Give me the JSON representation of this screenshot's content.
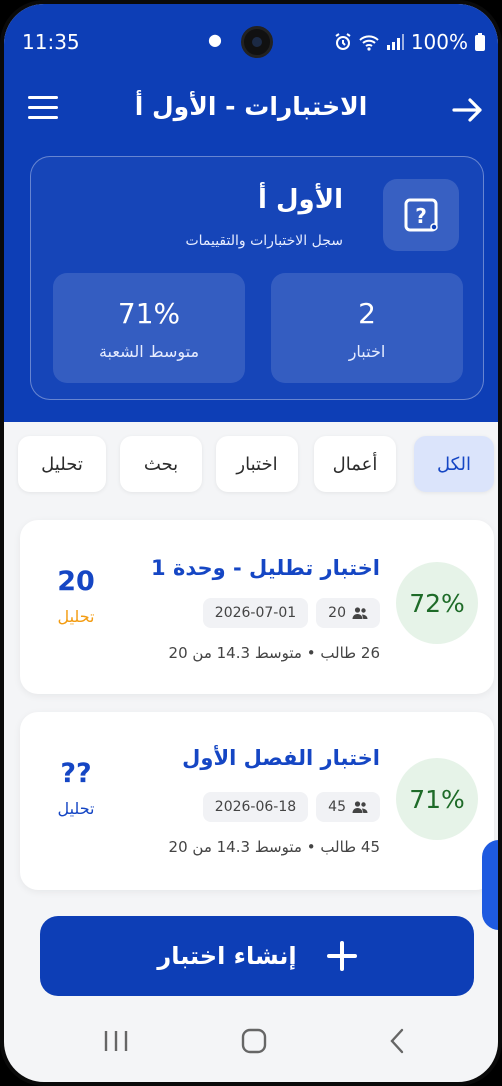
{
  "status_bar": {
    "time": "11:35",
    "battery": "100%"
  },
  "app_bar": {
    "title": "الاختبارات - الأول أ"
  },
  "summary": {
    "class_name": "الأول أ",
    "subtitle": "سجل الاختبارات والتقييمات",
    "count_value": "2",
    "count_label": "اختبار",
    "avg_value": "71%",
    "avg_label": "متوسط الشعبة"
  },
  "filters": [
    {
      "label": "الكل",
      "active": true
    },
    {
      "label": "أعمال"
    },
    {
      "label": "اختبار"
    },
    {
      "label": "بحث"
    },
    {
      "label": "تحليل"
    }
  ],
  "exams": [
    {
      "percent": "72%",
      "title": "اختبار تطليل - وحدة 1",
      "date": "2026-07-01",
      "students_count": "20",
      "info": "26 طالب • متوسط 14.3 من 20",
      "score": "20",
      "score_label": "تحليل"
    },
    {
      "percent": "71%",
      "title": "اختبار الفصل الأول",
      "date": "2026-06-18",
      "students_count": "45",
      "info": "45 طالب • متوسط 14.3 من 20",
      "score": "??",
      "score_label": "تحليل"
    }
  ],
  "create_button": {
    "label": "إنشاء اختبار"
  },
  "colors": {
    "primary": "#0d3eb6",
    "accent": "#1546c4",
    "success": "#1e6b28",
    "warning": "#f39c12"
  }
}
